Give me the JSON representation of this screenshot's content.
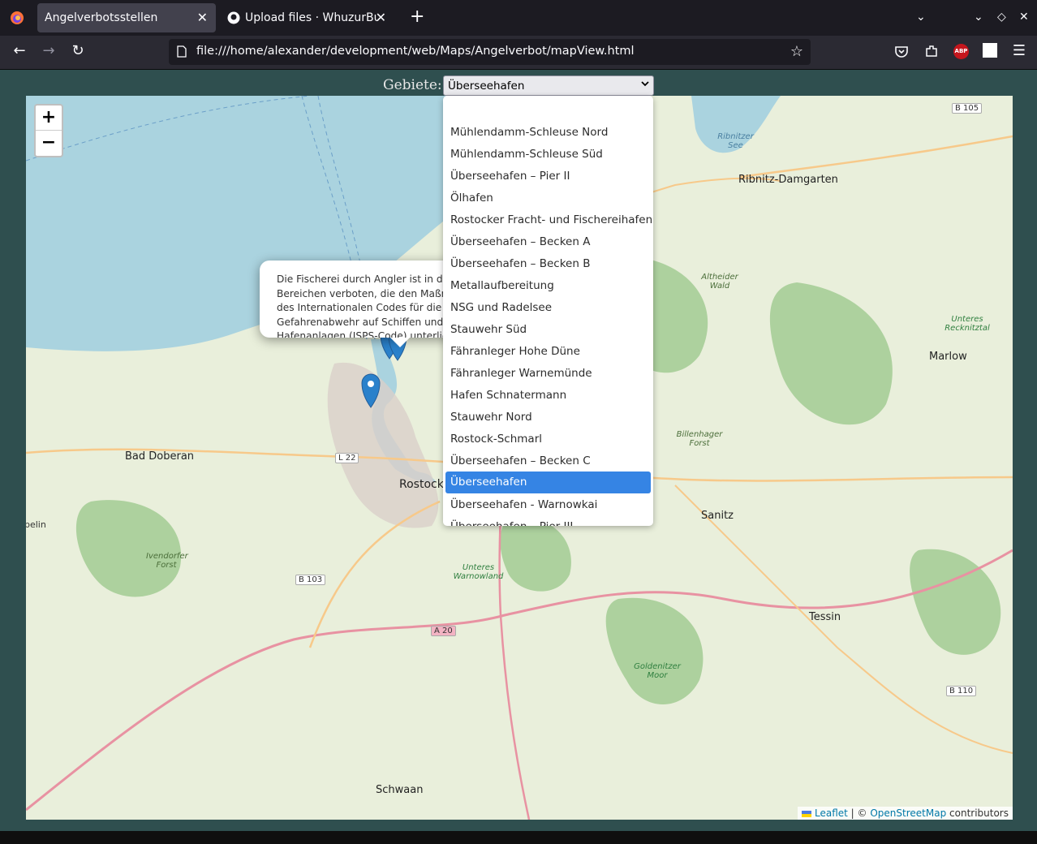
{
  "browser": {
    "tabs": [
      {
        "title": "Angelverbotsstellen",
        "active": true
      },
      {
        "title": "Upload files · WhuzurBuddy",
        "active": false
      }
    ],
    "url": "file:///home/alexander/development/web/Maps/Angelverbot/mapView.html"
  },
  "page": {
    "areas_label": "Gebiete:",
    "selected_area": "Überseehafen",
    "options": [
      "",
      "Mühlendamm-Schleuse Nord",
      "Mühlendamm-Schleuse Süd",
      "Überseehafen – Pier II",
      "Ölhafen",
      "Rostocker Fracht- und Fischereihafen",
      "Überseehafen – Becken A",
      "Überseehafen – Becken B",
      "Metallaufbereitung",
      "NSG und Radelsee",
      "Stauwehr Süd",
      "Fähranleger Hohe Düne",
      "Fähranleger Warnemünde",
      "Hafen Schnatermann",
      "Stauwehr Nord",
      "Rostock-Schmarl",
      "Überseehafen – Becken C",
      "Überseehafen",
      "Überseehafen - Warnowkai",
      "Überseehafen – Pier III"
    ]
  },
  "map": {
    "zoom_in": "+",
    "zoom_out": "−",
    "popup_text": "Die Fischerei durch Angler ist in den Bereichen verboten, die den Maßnahmen des Internationalen Codes für die Gefahrenabwehr auf Schiffen und in Hafenanlagen (ISPS-Code) unterliegen.",
    "attribution": {
      "leaflet": "Leaflet",
      "sep": " | © ",
      "osm": "OpenStreetMap",
      "suffix": " contributors"
    },
    "places": {
      "bad_doberan": "Bad Doberan",
      "rostock": "Rostock",
      "ribnitz": "Ribnitz-Damgarten",
      "marlow": "Marlow",
      "sanitz": "Sanitz",
      "tessin": "Tessin",
      "schwaan": "Schwaan",
      "ivendorfer": "Ivendorfer Forst",
      "altheider": "Altheider Wald",
      "billenhager": "Billenhager Forst",
      "recknitztal": "Unteres Recknitztal",
      "warnowland": "Unteres Warnowland",
      "goldenitzer": "Goldenitzer Moor",
      "ribnitzer_see": "Ribnitzer See",
      "belin": "belin"
    },
    "roads": {
      "b105": "B 105",
      "l22": "L 22",
      "b103": "B 103",
      "a20": "A 20",
      "b110": "B 110"
    },
    "colors": {
      "water": "#aad3df",
      "land": "#e9efdb",
      "forest": "#add19e",
      "motorway": "#e892a2",
      "marker": "#2a81cb"
    }
  },
  "icons": [
    "firefox-icon",
    "github-icon",
    "page-icon",
    "bookmark-star-icon",
    "pocket-icon",
    "extensions-icon",
    "adblock-icon",
    "menu-icon"
  ]
}
